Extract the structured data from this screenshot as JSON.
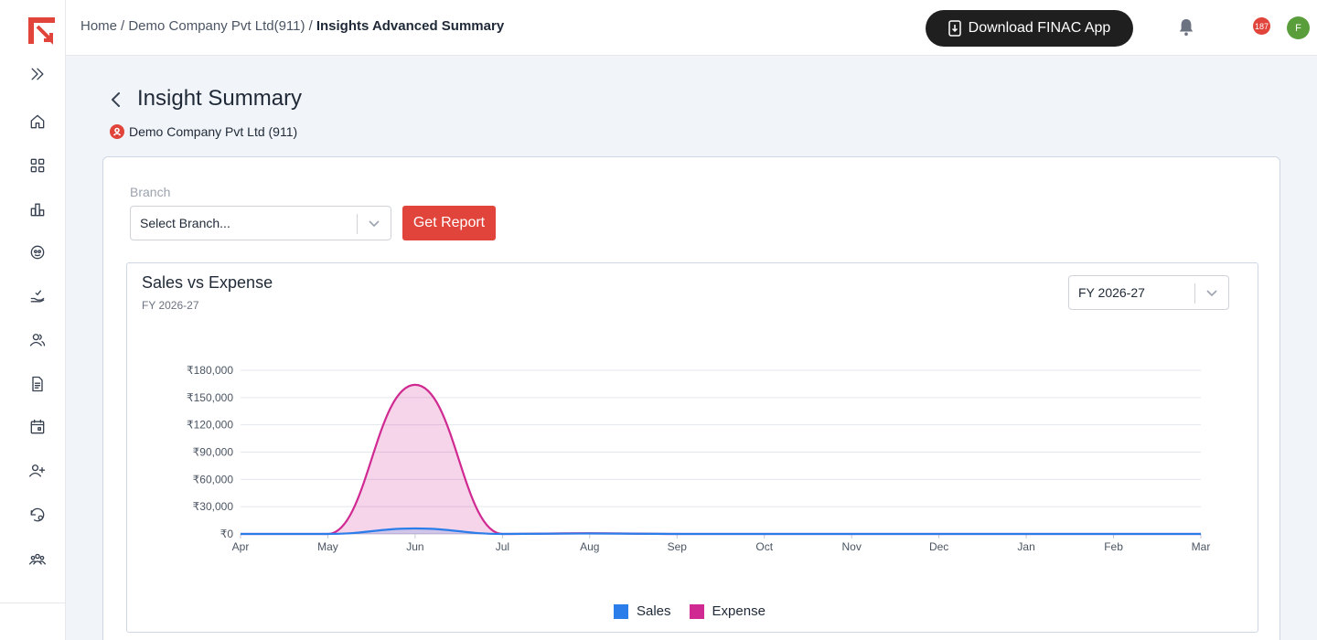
{
  "breadcrumb": {
    "home": "Home",
    "company": "/ Demo Company Pvt Ltd(911) /",
    "current": "Insights Advanced Summary"
  },
  "topbar": {
    "download_label": "Download FINAC App",
    "notification_count": "187",
    "avatar_initial": "F"
  },
  "sidebar": {
    "items": [
      "expand-icon",
      "home-icon",
      "dashboard-grid-icon",
      "bar-chart-icon",
      "user-circle-icon",
      "hand-check-icon",
      "users-icon",
      "document-icon",
      "calendar-icon",
      "user-plus-icon",
      "history-settings-icon",
      "team-icon"
    ]
  },
  "page": {
    "title": "Insight Summary",
    "company": "Demo Company Pvt Ltd (911)"
  },
  "filters": {
    "branch_label": "Branch",
    "branch_placeholder": "Select Branch...",
    "get_report_label": "Get Report"
  },
  "chart_panel": {
    "title": "Sales vs Expense",
    "subtitle": "FY 2026-27",
    "fy_selected": "FY 2026-27"
  },
  "colors": {
    "accent": "#e0443a",
    "sales": "#2b7de9",
    "expense": "#d02a92"
  },
  "chart_data": {
    "type": "area",
    "categories": [
      "Apr",
      "May",
      "Jun",
      "Jul",
      "Aug",
      "Sep",
      "Oct",
      "Nov",
      "Dec",
      "Jan",
      "Feb",
      "Mar"
    ],
    "series": [
      {
        "name": "Sales",
        "values": [
          0,
          0,
          6000,
          0,
          500,
          0,
          0,
          0,
          0,
          0,
          0,
          0
        ]
      },
      {
        "name": "Expense",
        "values": [
          0,
          0,
          164000,
          0,
          800,
          0,
          0,
          0,
          0,
          0,
          0,
          0
        ]
      }
    ],
    "yticks": [
      "₹0",
      "₹30,000",
      "₹60,000",
      "₹90,000",
      "₹120,000",
      "₹150,000",
      "₹180,000"
    ],
    "ylim": [
      0,
      180000
    ],
    "grid": true,
    "legend": "bottom-center"
  }
}
